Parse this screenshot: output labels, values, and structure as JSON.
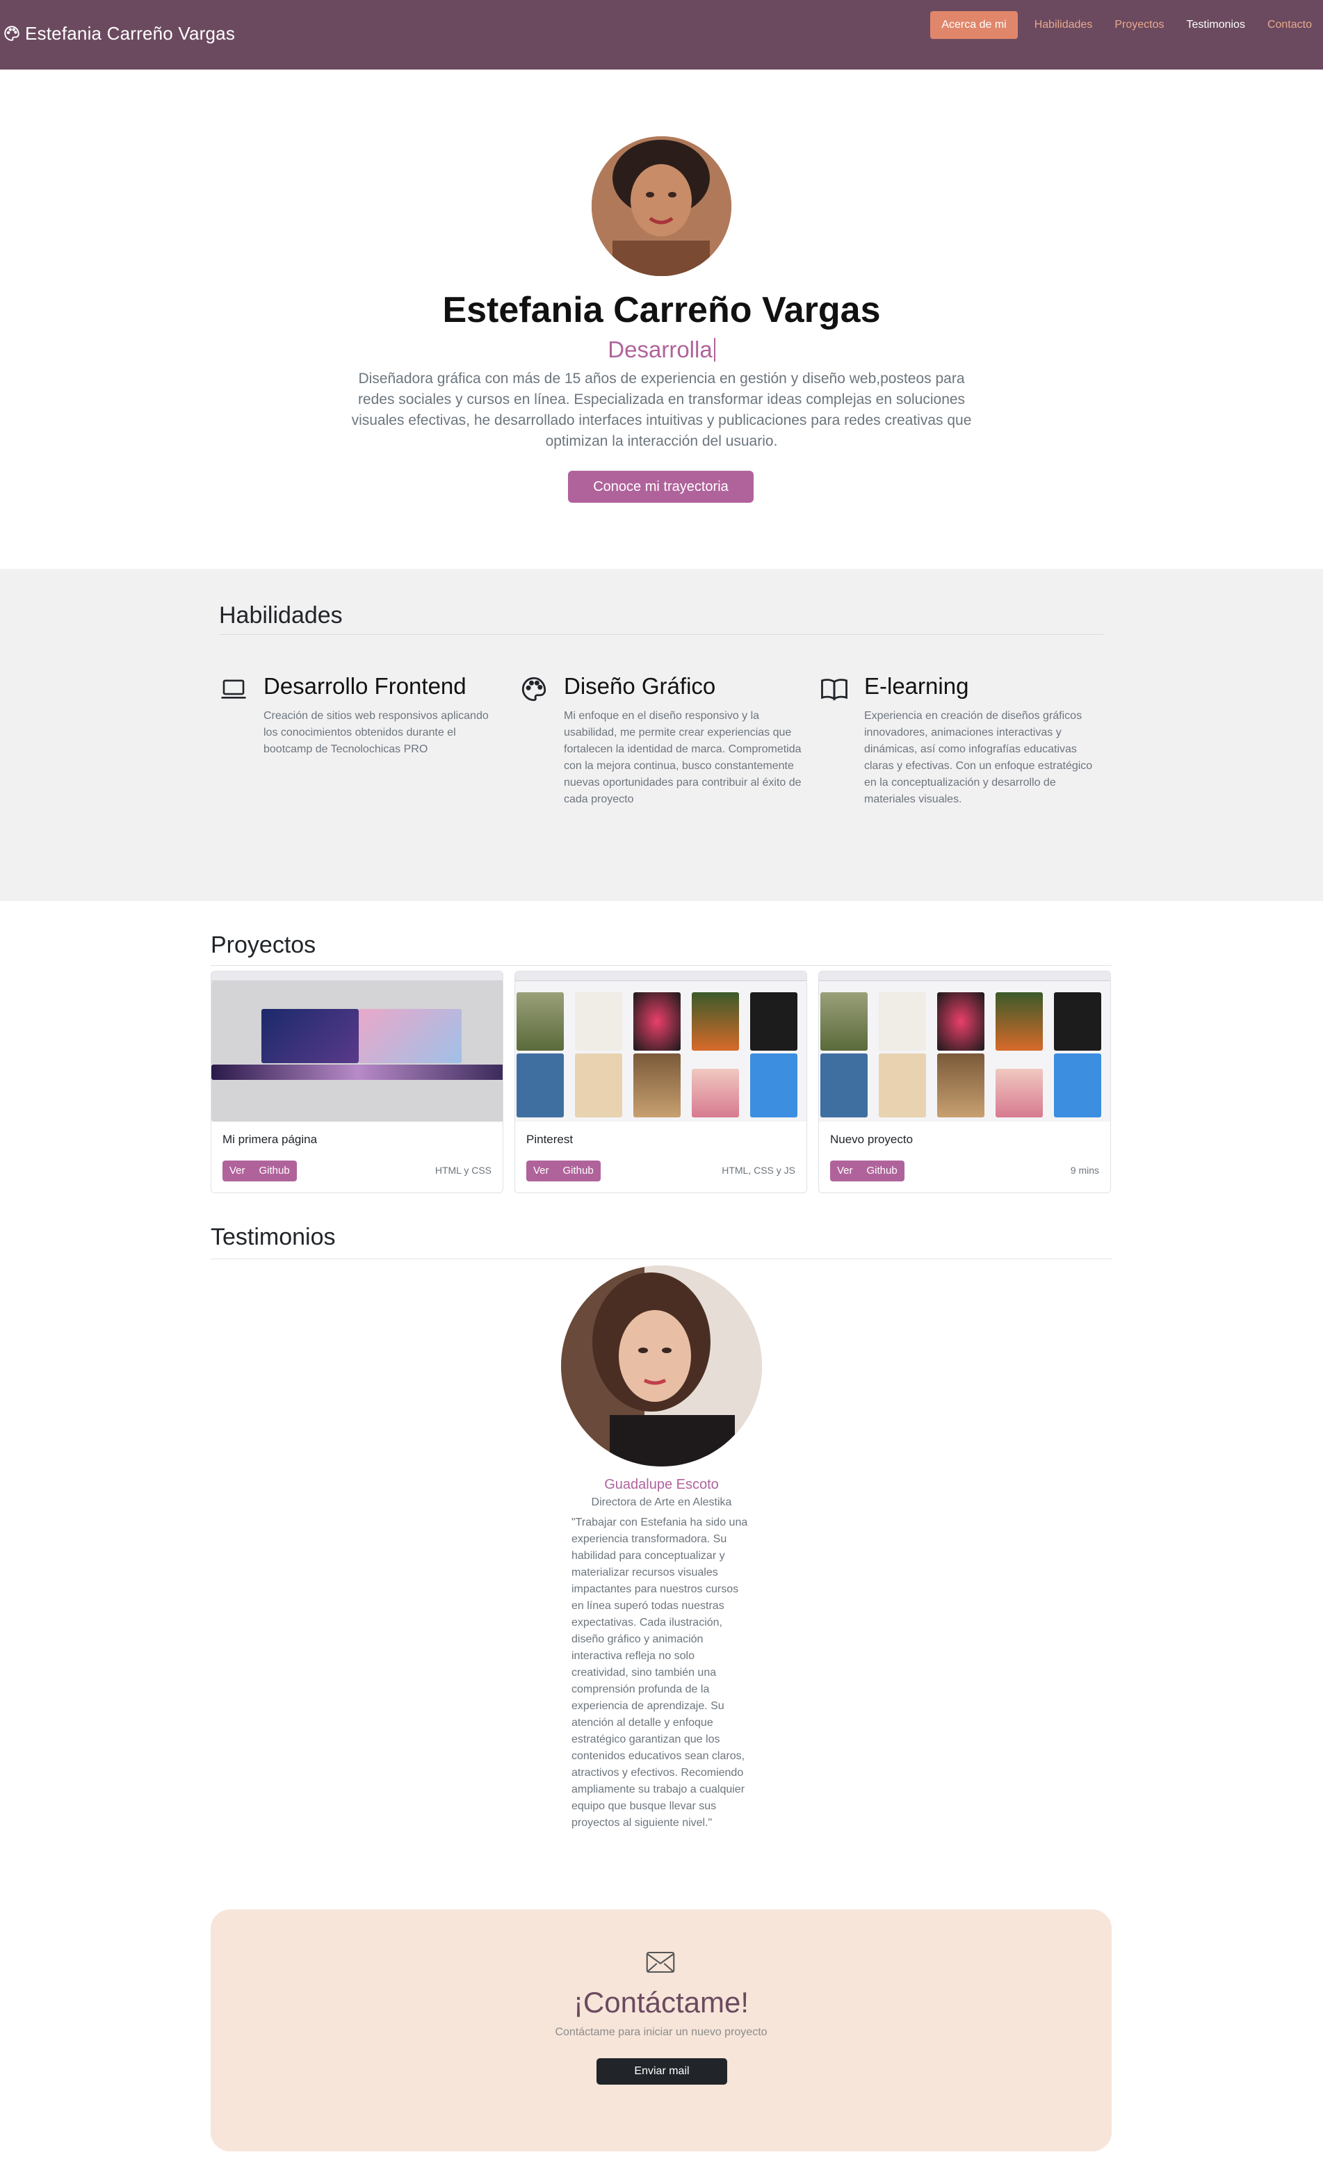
{
  "navbar": {
    "brand": "Estefania Carreño Vargas",
    "brand_icon": "palette-icon",
    "items": [
      {
        "label": "Acerca de mi",
        "active": true
      },
      {
        "label": "Habilidades"
      },
      {
        "label": "Proyectos"
      },
      {
        "label": "Testimonios"
      },
      {
        "label": "Contacto"
      }
    ]
  },
  "hero": {
    "name": "Estefania Carreño Vargas",
    "role": "Desarrolla",
    "description": "Diseñadora gráfica con más de 15 años de experiencia en gestión y diseño web,posteos para redes sociales y cursos en línea. Especializada en transformar ideas complejas en soluciones visuales efectivas, he desarrollado interfaces intuitivas y publicaciones para redes creativas que optimizan la interacción del usuario.",
    "button": "Conoce mi trayectoria"
  },
  "skills": {
    "title": "Habilidades",
    "items": [
      {
        "icon": "laptop-icon",
        "title": "Desarrollo Frontend",
        "text": "Creación de sitios web responsivos aplicando los conocimientos obtenidos durante el bootcamp de Tecnolochicas PRO"
      },
      {
        "icon": "palette-icon",
        "title": "Diseño Gráfico",
        "text": "Mi enfoque en el diseño responsivo y la usabilidad, me permite crear experiencias que fortalecen la identidad de marca. Comprometida con la mejora continua, busco constantemente nuevas oportunidades para contribuir al éxito de cada proyecto"
      },
      {
        "icon": "book-icon",
        "title": "E-learning",
        "text": "Experiencia en creación de diseños gráficos innovadores, animaciones interactivas y dinámicas, así como infografías educativas claras y efectivas. Con un enfoque estratégico en la conceptualización y desarrollo de materiales visuales."
      }
    ]
  },
  "projects": {
    "title": "Proyectos",
    "items": [
      {
        "title": "Mi primera página",
        "view": "Ver",
        "github": "Github",
        "meta": "HTML y CSS"
      },
      {
        "title": "Pinterest",
        "view": "Ver",
        "github": "Github",
        "meta": "HTML, CSS y JS"
      },
      {
        "title": "Nuevo proyecto",
        "view": "Ver",
        "github": "Github",
        "meta": "9 mins"
      }
    ]
  },
  "testimonials": {
    "title": "Testimonios",
    "name": "Guadalupe Escoto",
    "role": "Directora de Arte en Alestika",
    "quote": "\"Trabajar con Estefania ha sido una experiencia transformadora. Su habilidad para conceptualizar y materializar recursos visuales impactantes para nuestros cursos en línea superó todas nuestras expectativas. Cada ilustración, diseño gráfico y animación interactiva refleja no solo creatividad, sino también una comprensión profunda de la experiencia de aprendizaje. Su atención al detalle y enfoque estratégico garantizan que los contenidos educativos sean claros, atractivos y efectivos. Recomiendo ampliamente su trabajo a cualquier equipo que busque llevar sus proyectos al siguiente nivel.\""
  },
  "contact": {
    "icon": "envelope-icon",
    "title": "¡Contáctame!",
    "subtitle": "Contáctame para iniciar un nuevo proyecto",
    "button": "Enviar mail"
  },
  "colors": {
    "navbar": "#6b4a5f",
    "accent": "#b0639b",
    "nav_active": "#e0866a",
    "skills_bg": "#f2f1f2",
    "contact_bg": "#f7e5da"
  }
}
